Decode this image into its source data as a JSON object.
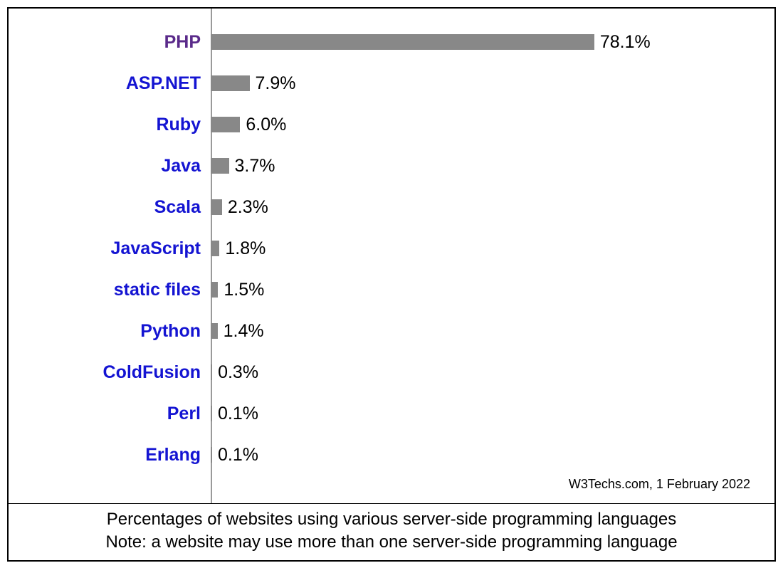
{
  "chart_data": {
    "type": "bar",
    "orientation": "horizontal",
    "categories": [
      "PHP",
      "ASP.NET",
      "Ruby",
      "Java",
      "Scala",
      "JavaScript",
      "static files",
      "Python",
      "ColdFusion",
      "Perl",
      "Erlang"
    ],
    "values": [
      78.1,
      7.9,
      6.0,
      3.7,
      2.3,
      1.8,
      1.5,
      1.4,
      0.3,
      0.1,
      0.1
    ],
    "value_suffix": "%",
    "xlim": [
      0,
      100
    ],
    "bar_color": "#888888",
    "label_link_color": "#1414d2",
    "label_visited_color": "#5a2a8a",
    "visited_indices": [
      0
    ]
  },
  "labels": {
    "0": "PHP",
    "1": "ASP.NET",
    "2": "Ruby",
    "3": "Java",
    "4": "Scala",
    "5": "JavaScript",
    "6": "static files",
    "7": "Python",
    "8": "ColdFusion",
    "9": "Perl",
    "10": "Erlang"
  },
  "value_text": {
    "0": "78.1%",
    "1": "7.9%",
    "2": "6.0%",
    "3": "3.7%",
    "4": "2.3%",
    "5": "1.8%",
    "6": "1.5%",
    "7": "1.4%",
    "8": "0.3%",
    "9": "0.1%",
    "10": "0.1%"
  },
  "source_line": "W3Techs.com, 1 February 2022",
  "caption_line1": "Percentages of websites using various server-side programming languages",
  "caption_line2": "Note: a website may use more than one server-side programming language"
}
